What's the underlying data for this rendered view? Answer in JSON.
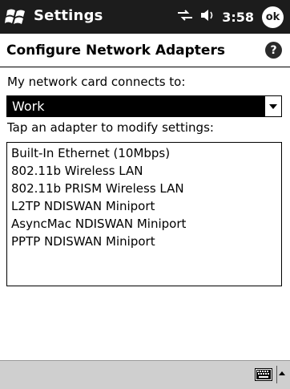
{
  "titlebar": {
    "title": "Settings",
    "clock": "3:58",
    "ok_label": "ok",
    "icons": [
      "windows-flag-icon",
      "connectivity-icon",
      "speaker-icon"
    ]
  },
  "header": {
    "title": "Configure Network Adapters",
    "help_label": "?"
  },
  "connects_label": "My network card connects to:",
  "network_select": {
    "value": "Work"
  },
  "adapters_label": "Tap an adapter to modify settings:",
  "adapters": [
    "Built-In Ethernet (10Mbps)",
    "802.11b Wireless LAN",
    "802.11b PRISM Wireless LAN",
    "L2TP NDISWAN Miniport",
    "AsyncMac NDISWAN Miniport",
    "PPTP NDISWAN Miniport"
  ],
  "bottombar": {
    "icons": [
      "keyboard-icon",
      "input-panel-arrow-icon"
    ]
  },
  "colors": {
    "titlebar": "#1c1c1c",
    "selection": "#000000",
    "bottombar": "#cfcfcf"
  }
}
